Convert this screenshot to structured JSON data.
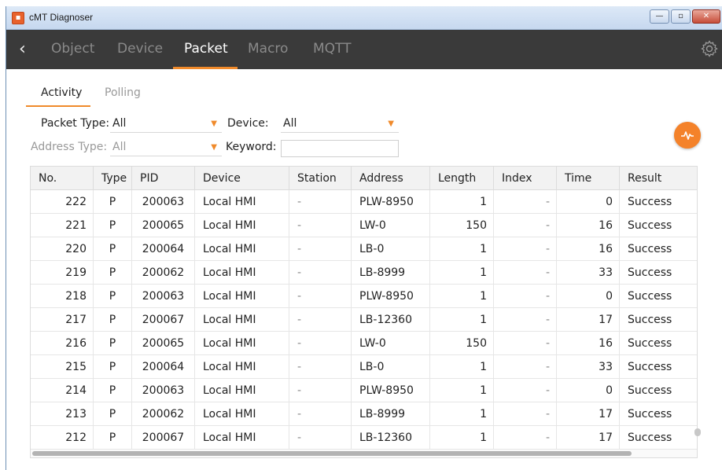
{
  "window": {
    "title": "cMT Diagnoser",
    "icon": "app-logo-icon"
  },
  "nav": {
    "back_icon": "chevron-left-icon",
    "tabs": [
      {
        "label": "Object",
        "active": false
      },
      {
        "label": "Device",
        "active": false
      },
      {
        "label": "Packet",
        "active": true
      },
      {
        "label": "Macro",
        "active": false
      },
      {
        "label": "MQTT",
        "active": false
      }
    ],
    "settings_icon": "gear-icon"
  },
  "subtabs": [
    {
      "label": "Activity",
      "active": true
    },
    {
      "label": "Polling",
      "active": false
    }
  ],
  "filters": {
    "packet_type_label": "Packet Type:",
    "packet_type_value": "All",
    "device_label": "Device:",
    "device_value": "All",
    "address_type_label": "Address Type:",
    "address_type_value": "All",
    "keyword_label": "Keyword:",
    "keyword_value": ""
  },
  "activity_button_icon": "activity-pulse-icon",
  "accent_color": "#f08a2b",
  "table": {
    "columns": [
      "No.",
      "Type",
      "PID",
      "Device",
      "Station",
      "Address",
      "Length",
      "Index",
      "Time",
      "Result"
    ],
    "rows": [
      [
        "222",
        "P",
        "200063",
        "Local HMI",
        "-",
        "PLW-8950",
        "1",
        "-",
        "0",
        "Success"
      ],
      [
        "221",
        "P",
        "200065",
        "Local HMI",
        "-",
        "LW-0",
        "150",
        "-",
        "16",
        "Success"
      ],
      [
        "220",
        "P",
        "200064",
        "Local HMI",
        "-",
        "LB-0",
        "1",
        "-",
        "16",
        "Success"
      ],
      [
        "219",
        "P",
        "200062",
        "Local HMI",
        "-",
        "LB-8999",
        "1",
        "-",
        "33",
        "Success"
      ],
      [
        "218",
        "P",
        "200063",
        "Local HMI",
        "-",
        "PLW-8950",
        "1",
        "-",
        "0",
        "Success"
      ],
      [
        "217",
        "P",
        "200067",
        "Local HMI",
        "-",
        "LB-12360",
        "1",
        "-",
        "17",
        "Success"
      ],
      [
        "216",
        "P",
        "200065",
        "Local HMI",
        "-",
        "LW-0",
        "150",
        "-",
        "16",
        "Success"
      ],
      [
        "215",
        "P",
        "200064",
        "Local HMI",
        "-",
        "LB-0",
        "1",
        "-",
        "33",
        "Success"
      ],
      [
        "214",
        "P",
        "200063",
        "Local HMI",
        "-",
        "PLW-8950",
        "1",
        "-",
        "0",
        "Success"
      ],
      [
        "213",
        "P",
        "200062",
        "Local HMI",
        "-",
        "LB-8999",
        "1",
        "-",
        "17",
        "Success"
      ],
      [
        "212",
        "P",
        "200067",
        "Local HMI",
        "-",
        "LB-12360",
        "1",
        "-",
        "17",
        "Success"
      ]
    ]
  }
}
